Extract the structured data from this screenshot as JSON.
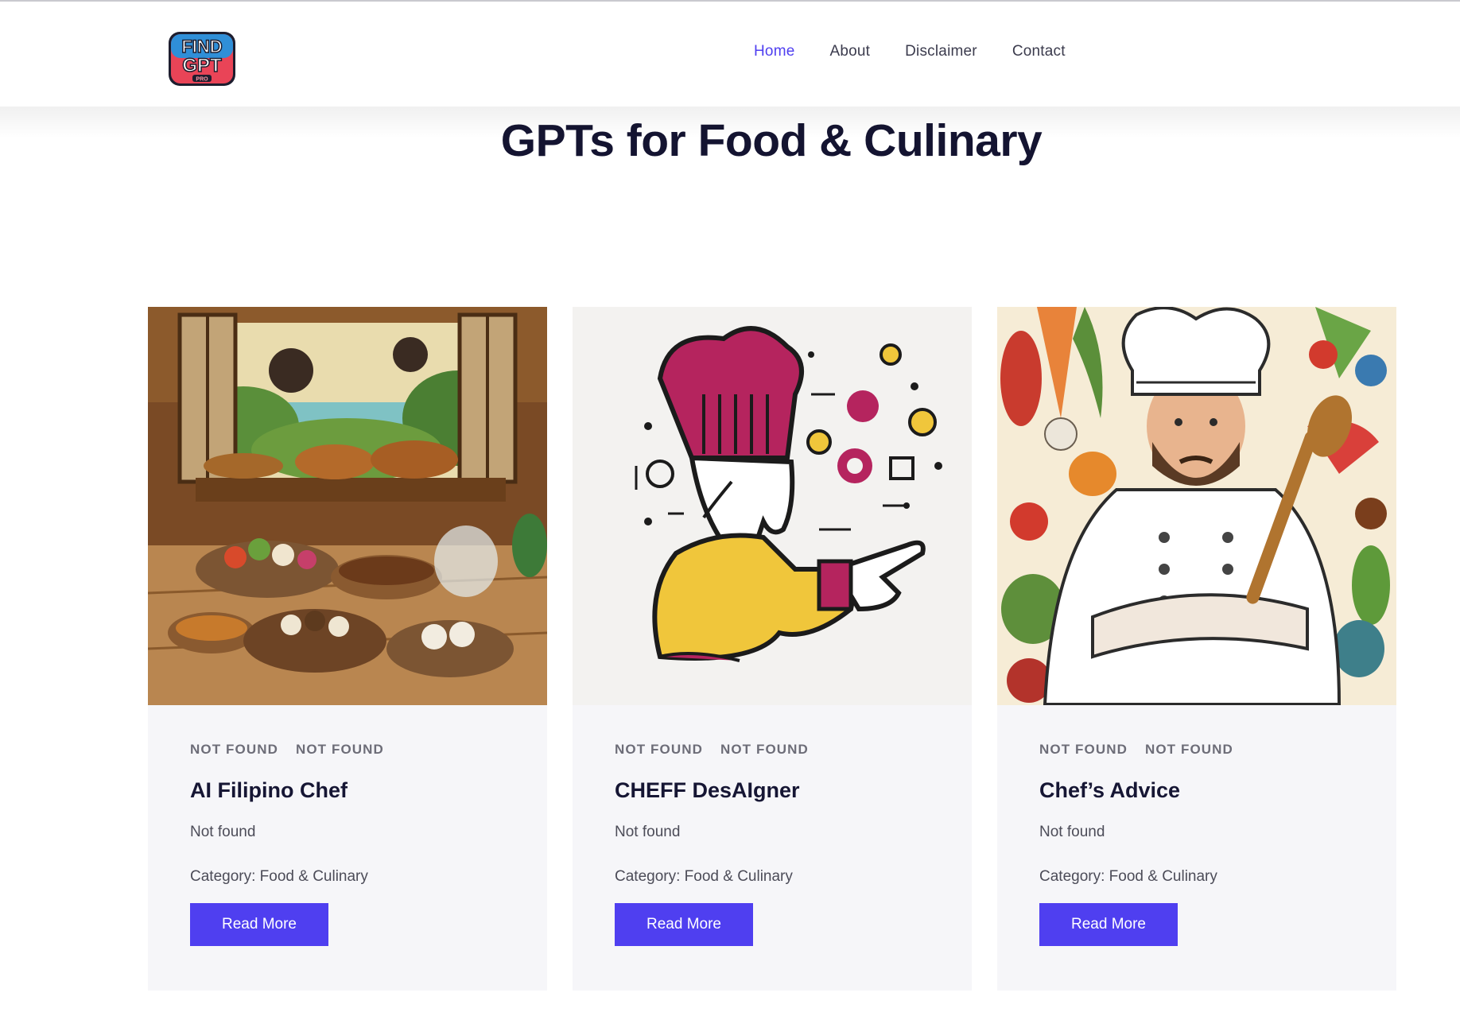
{
  "header": {
    "logo_text": [
      "FIND",
      "GPT",
      "PRO"
    ],
    "nav": [
      {
        "label": "Home",
        "active": true
      },
      {
        "label": "About",
        "active": false
      },
      {
        "label": "Disclaimer",
        "active": false
      },
      {
        "label": "Contact",
        "active": false
      }
    ]
  },
  "page": {
    "title": "GPTs for Food & Culinary"
  },
  "cards": [
    {
      "image": "filipino-kitchen-feast-illustration",
      "tags": [
        "NOT FOUND",
        "NOT FOUND"
      ],
      "title": "AI Filipino Chef",
      "description": "Not found",
      "category": "Category: Food & Culinary",
      "button": "Read More"
    },
    {
      "image": "chef-pointing-icons-illustration",
      "tags": [
        "NOT FOUND",
        "NOT FOUND"
      ],
      "title": "CHEFF DesAIgner",
      "description": "Not found",
      "category": "Category: Food & Culinary",
      "button": "Read More"
    },
    {
      "image": "chef-with-vegetables-illustration",
      "tags": [
        "NOT FOUND",
        "NOT FOUND"
      ],
      "title": "Chef’s Advice",
      "description": "Not found",
      "category": "Category: Food & Culinary",
      "button": "Read More"
    }
  ],
  "colors": {
    "accent": "#4f3ff0",
    "title": "#141431",
    "card_bg": "#f6f6f9",
    "muted": "#6d6d78"
  }
}
